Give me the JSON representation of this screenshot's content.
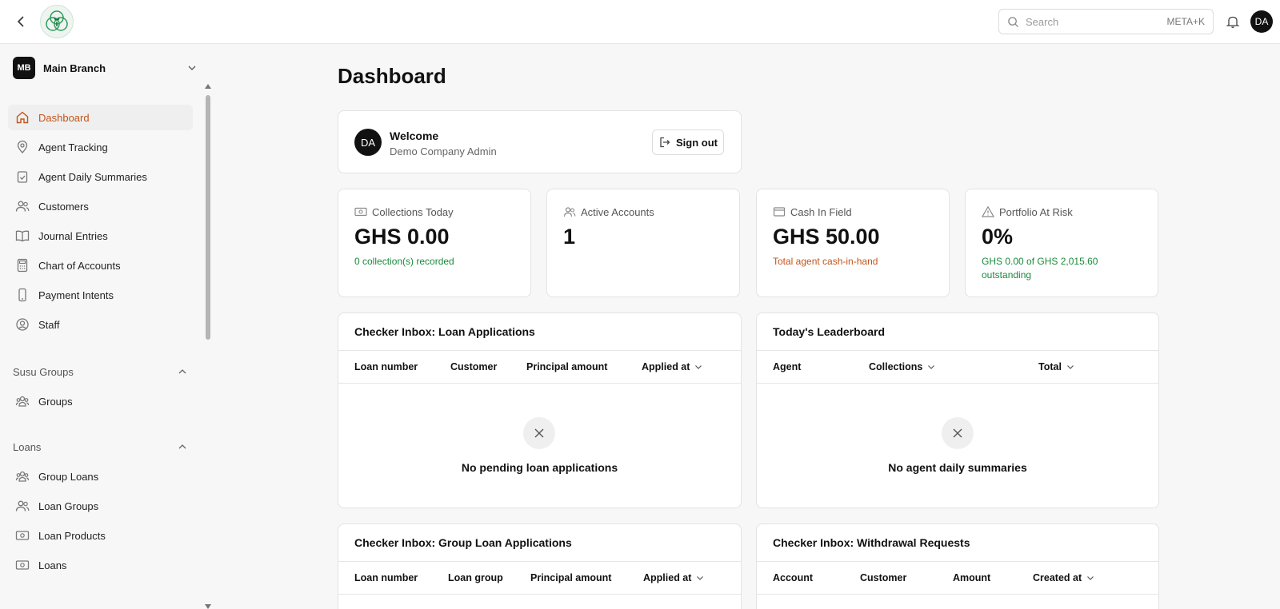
{
  "topbar": {
    "search_placeholder": "Search",
    "search_shortcut": "META+K",
    "avatar_initials": "DA"
  },
  "sidebar": {
    "branch_badge": "MB",
    "branch_name": "Main Branch",
    "items": [
      {
        "label": "Dashboard",
        "icon": "home-icon",
        "active": true
      },
      {
        "label": "Agent Tracking",
        "icon": "map-pin-icon"
      },
      {
        "label": "Agent Daily Summaries",
        "icon": "clipboard-check-icon"
      },
      {
        "label": "Customers",
        "icon": "users-icon"
      },
      {
        "label": "Journal Entries",
        "icon": "book-open-icon"
      },
      {
        "label": "Chart of Accounts",
        "icon": "calculator-icon"
      },
      {
        "label": "Payment Intents",
        "icon": "smartphone-icon"
      },
      {
        "label": "Staff",
        "icon": "user-circle-icon"
      }
    ],
    "sections": [
      {
        "label": "Susu Groups",
        "items": [
          {
            "label": "Groups",
            "icon": "user-group-icon"
          }
        ]
      },
      {
        "label": "Loans",
        "items": [
          {
            "label": "Group Loans",
            "icon": "user-group-icon"
          },
          {
            "label": "Loan Groups",
            "icon": "users-icon"
          },
          {
            "label": "Loan Products",
            "icon": "banknote-icon"
          },
          {
            "label": "Loans",
            "icon": "banknote-icon"
          }
        ]
      }
    ]
  },
  "main": {
    "title": "Dashboard",
    "welcome": {
      "initials": "DA",
      "greeting": "Welcome",
      "role": "Demo Company Admin",
      "signout_label": "Sign out"
    },
    "stats": [
      {
        "label": "Collections Today",
        "value": "GHS 0.00",
        "sub": "0 collection(s) recorded",
        "sub_color": "#1a8a3c",
        "icon": "banknote-icon"
      },
      {
        "label": "Active Accounts",
        "value": "1",
        "sub": "",
        "icon": "users-icon"
      },
      {
        "label": "Cash In Field",
        "value": "GHS 50.00",
        "sub": "Total agent cash-in-hand",
        "sub_color": "#c2561a",
        "icon": "wallet-icon"
      },
      {
        "label": "Portfolio At Risk",
        "value": "0%",
        "sub": "GHS 0.00 of GHS 2,015.60 outstanding",
        "sub_color": "#1a8a3c",
        "icon": "alert-triangle-icon"
      }
    ],
    "panels": {
      "loan_apps": {
        "title": "Checker Inbox: Loan Applications",
        "columns": [
          "Loan number",
          "Customer",
          "Principal amount",
          "Applied at"
        ],
        "empty": "No pending loan applications"
      },
      "leaderboard": {
        "title": "Today's Leaderboard",
        "columns": [
          "Agent",
          "Collections",
          "Total"
        ],
        "empty": "No agent daily summaries"
      },
      "group_loan_apps": {
        "title": "Checker Inbox: Group Loan Applications",
        "columns": [
          "Loan number",
          "Loan group",
          "Principal amount",
          "Applied at"
        ]
      },
      "withdrawals": {
        "title": "Checker Inbox: Withdrawal Requests",
        "columns": [
          "Account",
          "Customer",
          "Amount",
          "Created at"
        ]
      }
    }
  },
  "colors": {
    "accent": "#c2561a",
    "positive": "#1a8a3c"
  }
}
